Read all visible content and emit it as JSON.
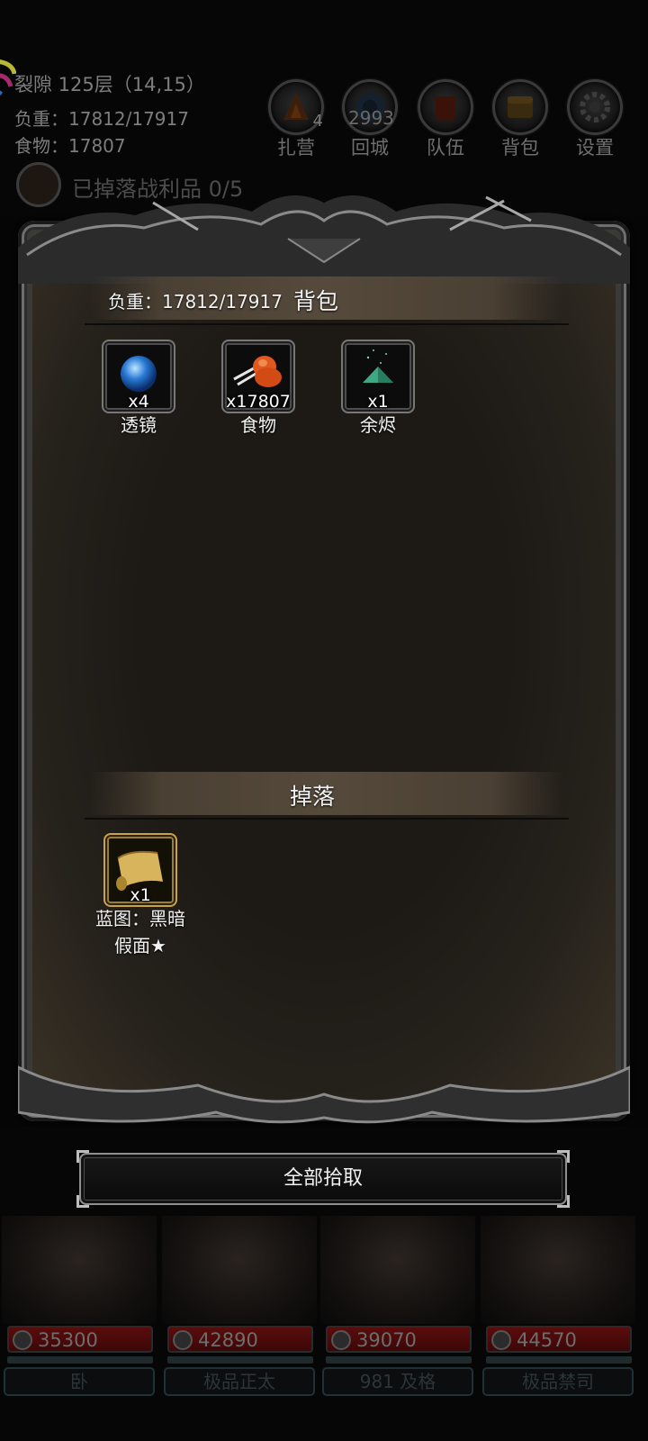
{
  "hud": {
    "location": "裂隙 125层（14,15）",
    "weight": "负重：17812/17917",
    "food": "食物：17807",
    "buttons": [
      {
        "label": "扎营",
        "badge": "4",
        "icon": "campfire-icon"
      },
      {
        "label": "回城",
        "badge": "2993",
        "icon": "portal-icon"
      },
      {
        "label": "队伍",
        "badge": "",
        "icon": "team-icon"
      },
      {
        "label": "背包",
        "badge": "",
        "icon": "chest-icon"
      },
      {
        "label": "设置",
        "badge": "",
        "icon": "gear-icon"
      }
    ],
    "loot_counter": "已掉落战利品 0/5"
  },
  "panel": {
    "bag": {
      "title": "背包",
      "weight": "负重：17812/17917",
      "items": [
        {
          "name": "透镜",
          "qty": "x4",
          "icon": "lens-icon"
        },
        {
          "name": "食物",
          "qty": "x17807",
          "icon": "food-icon"
        },
        {
          "name": "余烬",
          "qty": "x1",
          "icon": "ember-icon"
        }
      ]
    },
    "drops": {
      "title": "掉落",
      "items": [
        {
          "name_line1": "蓝图：黑暗",
          "name_line2": "假面★",
          "qty": "x1",
          "icon": "blueprint-scroll-icon"
        }
      ]
    }
  },
  "pickup_all_label": "全部拾取",
  "party": [
    {
      "hp": "35300",
      "name": "卧"
    },
    {
      "hp": "42890",
      "name": "极品正太"
    },
    {
      "hp": "39070",
      "name": "981 及格"
    },
    {
      "hp": "44570",
      "name": "极品禁司"
    }
  ],
  "colors": {
    "panel_bg": "#1d1a16",
    "section_bar": "#554a3b",
    "hp_bar": "#5a0c0c",
    "button_border": "#8f8f8f"
  }
}
